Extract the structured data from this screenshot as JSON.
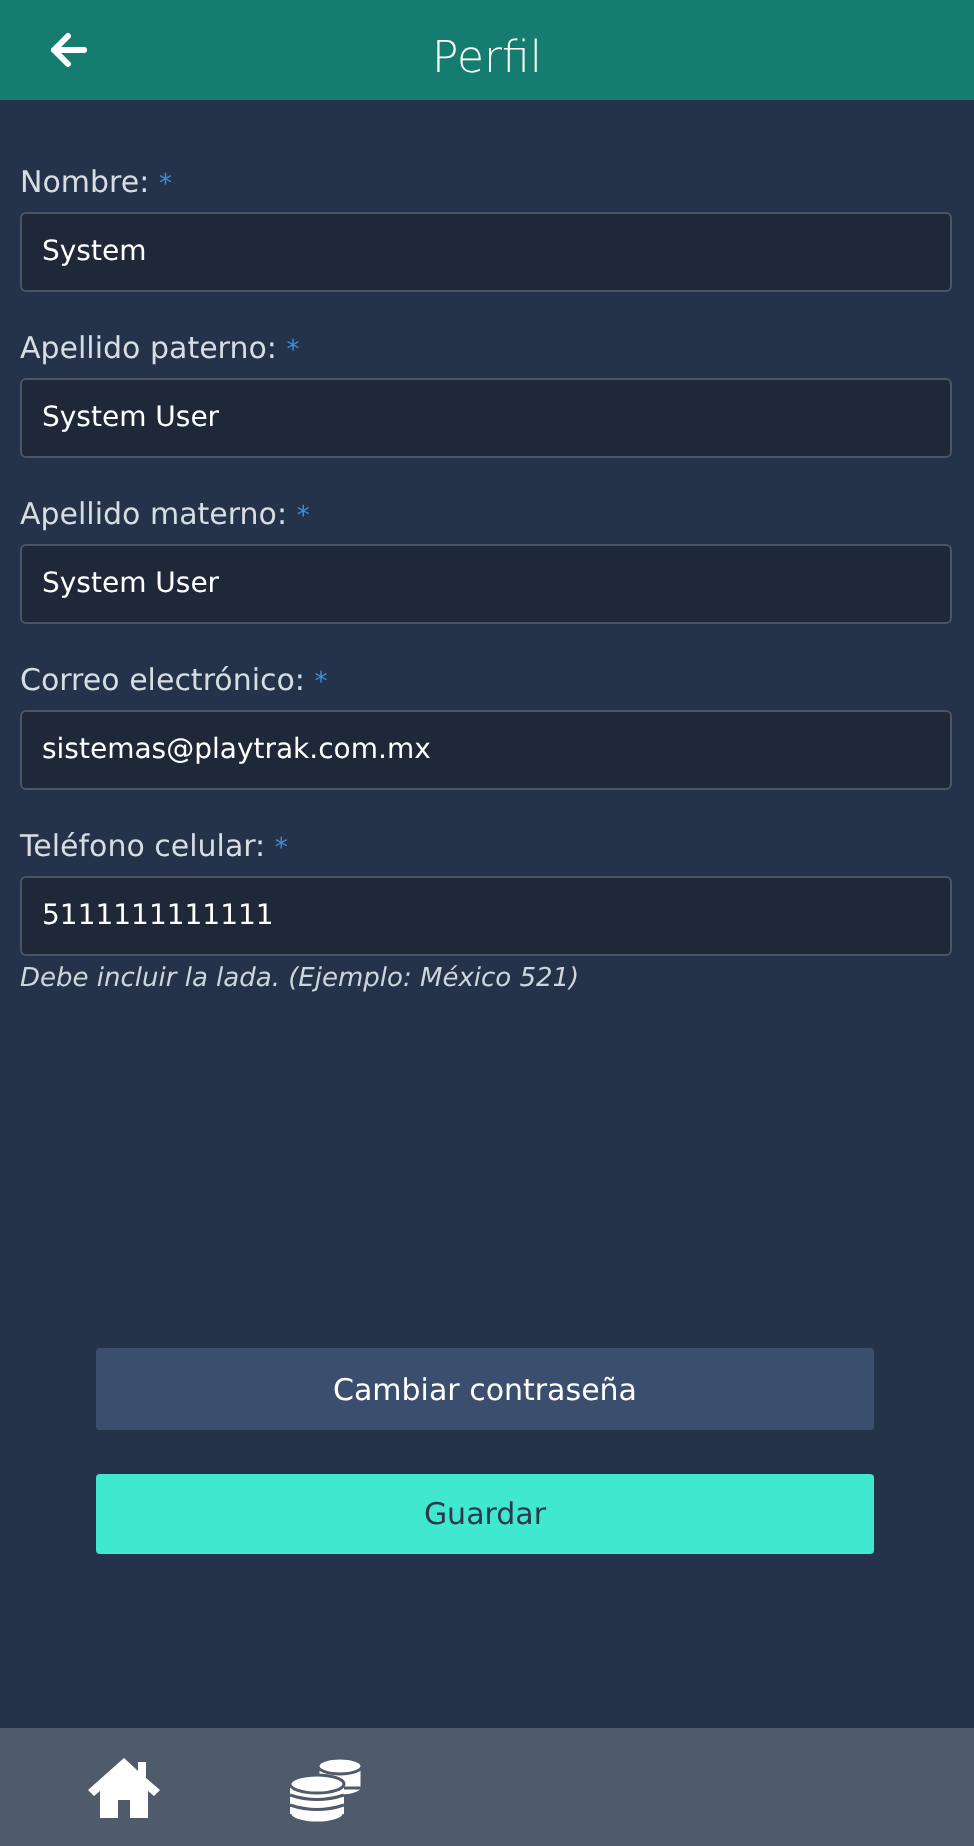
{
  "header": {
    "title": "Perfil"
  },
  "fields": [
    {
      "label": "Nombre:",
      "required_mark": "*",
      "value": "System"
    },
    {
      "label": "Apellido paterno:",
      "required_mark": "*",
      "value": "System User"
    },
    {
      "label": "Apellido materno:",
      "required_mark": "*",
      "value": "System User"
    },
    {
      "label": "Correo electrónico:",
      "required_mark": "*",
      "value": "sistemas@playtrak.com.mx"
    },
    {
      "label": "Teléfono celular:",
      "required_mark": "*",
      "value": "5111111111111",
      "hint": "Debe incluir la lada. (Ejemplo: México 521)"
    }
  ],
  "buttons": [
    {
      "label": "Cambiar contraseña",
      "kind": "secondary"
    },
    {
      "label": "Guardar",
      "kind": "primary"
    }
  ]
}
